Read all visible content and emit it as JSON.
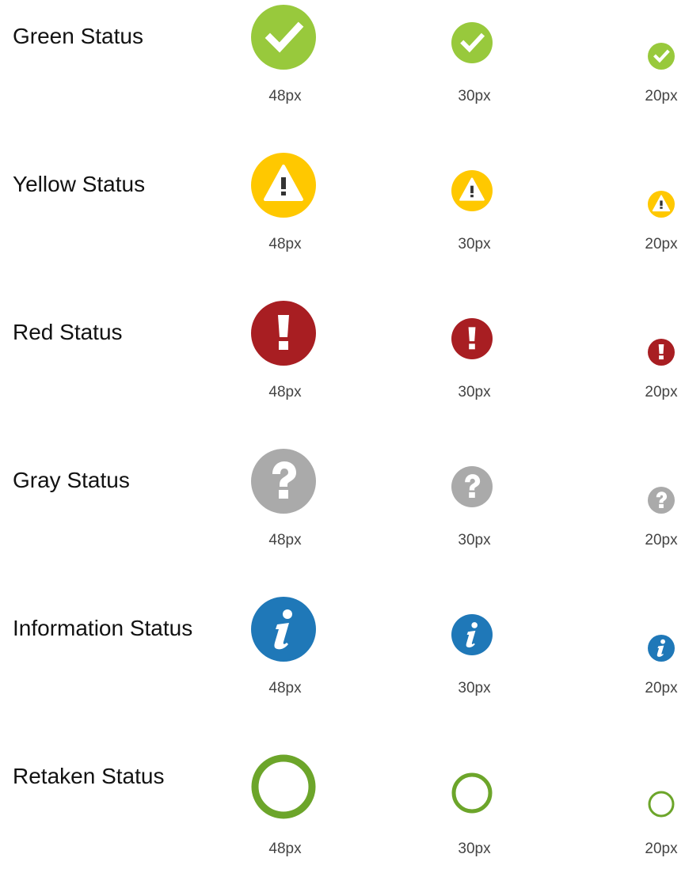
{
  "colors": {
    "green": "#98c93c",
    "yellow": "#ffc800",
    "red": "#a81e22",
    "gray": "#aaaaaa",
    "info": "#1f78b8",
    "retaken": "#6ca52a"
  },
  "rows": [
    {
      "label": "Green Status",
      "icon": "check-circle-icon",
      "sizes": [
        "48px",
        "30px",
        "20px"
      ]
    },
    {
      "label": "Yellow Status",
      "icon": "warning-circle-icon",
      "sizes": [
        "48px",
        "30px",
        "20px"
      ]
    },
    {
      "label": "Red Status",
      "icon": "exclamation-circle-icon",
      "sizes": [
        "48px",
        "30px",
        "20px"
      ]
    },
    {
      "label": "Gray Status",
      "icon": "question-circle-icon",
      "sizes": [
        "48px",
        "30px",
        "20px"
      ]
    },
    {
      "label": "Information Status",
      "icon": "info-circle-icon",
      "sizes": [
        "48px",
        "30px",
        "20px"
      ]
    },
    {
      "label": "Retaken Status",
      "icon": "ring-icon",
      "sizes": [
        "48px",
        "30px",
        "20px"
      ]
    }
  ]
}
